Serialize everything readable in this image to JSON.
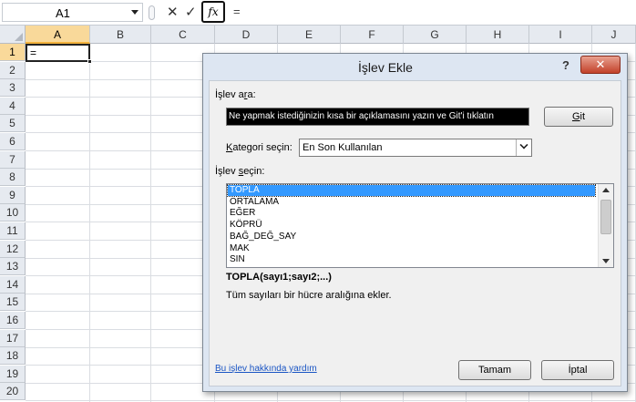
{
  "formula_bar": {
    "name_box": "A1",
    "cancel_glyph": "✕",
    "enter_glyph": "✓",
    "fx_label": "fx",
    "content": "="
  },
  "sheet": {
    "columns": [
      "A",
      "B",
      "C",
      "D",
      "E",
      "F",
      "G",
      "H",
      "I",
      "J"
    ],
    "rows": [
      "1",
      "2",
      "3",
      "4",
      "5",
      "6",
      "7",
      "8",
      "9",
      "10",
      "11",
      "12",
      "13",
      "14",
      "15",
      "16",
      "17",
      "18",
      "19",
      "20"
    ],
    "active_cell_value": "="
  },
  "dialog": {
    "title": "İşlev Ekle",
    "help_glyph": "?",
    "close_glyph": "✕",
    "search_label_pre": "İşlev a",
    "search_label_ul": "r",
    "search_label_post": "a:",
    "search_value": "Ne yapmak istediğinizin kısa bir açıklamasını yazın ve Git'i tıklatın",
    "go_button_ul": "G",
    "go_button_post": "it",
    "category_label_ul": "K",
    "category_label_post": "ategori seçin:",
    "category_value": "En Son Kullanılan",
    "function_label_pre": "İşlev ",
    "function_label_ul": "s",
    "function_label_post": "eçin:",
    "functions": [
      "TOPLA",
      "ORTALAMA",
      "EĞER",
      "KÖPRÜ",
      "BAĞ_DEĞ_SAY",
      "MAK",
      "SIN"
    ],
    "selected_index": 0,
    "signature": "TOPLA(sayı1;sayı2;...)",
    "description": "Tüm sayıları bir hücre aralığına ekler.",
    "help_link": "Bu işlev hakkında yardım",
    "ok_button": "Tamam",
    "cancel_button": "İptal"
  },
  "colors": {
    "header_bg": "#e6eaf0",
    "active_header_bg": "#f9d99a",
    "dialog_bg": "#dde6f2",
    "close_red": "#c2412a",
    "selection_blue": "#3399ff",
    "link_blue": "#1a55c4"
  },
  "icons": {
    "name_box_dropdown": "chevron-down-icon",
    "cancel": "close-icon",
    "enter": "check-icon",
    "insert_function": "fx-icon",
    "help": "help-icon",
    "close": "close-icon"
  }
}
